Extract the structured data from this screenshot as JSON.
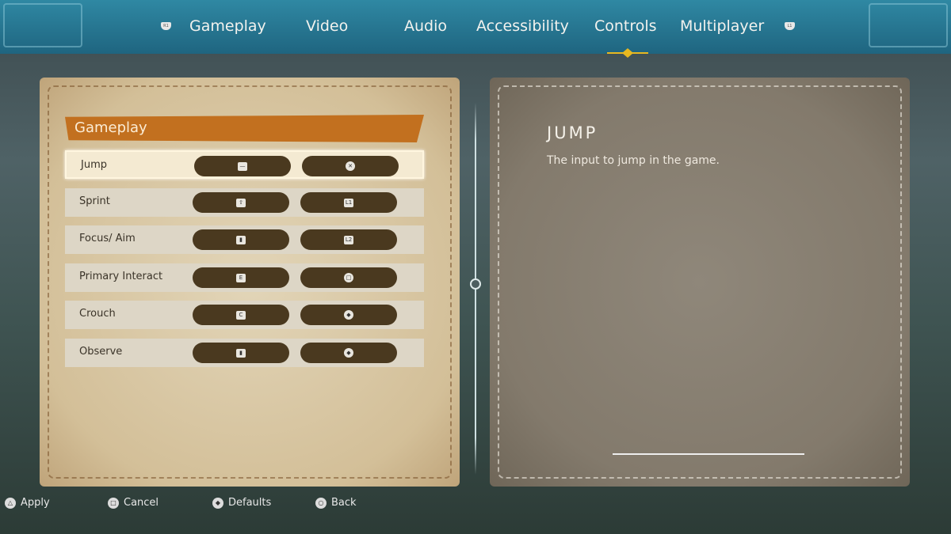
{
  "tabs": {
    "left_bumper": "R1",
    "right_bumper": "L1",
    "items": [
      {
        "label": "Gameplay"
      },
      {
        "label": "Video"
      },
      {
        "label": "Audio"
      },
      {
        "label": "Accessibility"
      },
      {
        "label": "Controls"
      },
      {
        "label": "Multiplayer"
      }
    ],
    "active": "Controls"
  },
  "section": {
    "title": "Gameplay"
  },
  "rows": [
    {
      "label": "Jump",
      "kb": "space-key",
      "pad": "cross-button",
      "kb_glyph": "—",
      "pad_glyph": "✕",
      "selected": true
    },
    {
      "label": "Sprint",
      "kb": "shift-key",
      "pad": "l1-button",
      "kb_glyph": "⇧",
      "pad_glyph": "L1"
    },
    {
      "label": "Focus/ Aim",
      "kb": "right-mouse",
      "pad": "l2-button",
      "kb_glyph": "▮",
      "pad_glyph": "L2"
    },
    {
      "label": "Primary Interact",
      "kb": "e-key",
      "pad": "square-button",
      "kb_glyph": "E",
      "pad_glyph": "□"
    },
    {
      "label": "Crouch",
      "kb": "c-key",
      "pad": "right-stick-press",
      "kb_glyph": "C",
      "pad_glyph": "◆"
    },
    {
      "label": "Observe",
      "kb": "middle-mouse",
      "pad": "right-stick-press",
      "kb_glyph": "▮",
      "pad_glyph": "◆"
    }
  ],
  "detail": {
    "title": "JUMP",
    "description": "The input to jump in the game."
  },
  "footer": [
    {
      "icon": "triangle-button",
      "glyph": "△",
      "label": "Apply"
    },
    {
      "icon": "square-button",
      "glyph": "□",
      "label": "Cancel"
    },
    {
      "icon": "right-stick-button",
      "glyph": "◆",
      "label": "Defaults"
    },
    {
      "icon": "circle-button",
      "glyph": "○",
      "label": "Back"
    }
  ],
  "colors": {
    "topbar": "#2a7f9a",
    "section_head": "#c2701f",
    "binding": "#4a391f",
    "accent": "#e8b820"
  }
}
